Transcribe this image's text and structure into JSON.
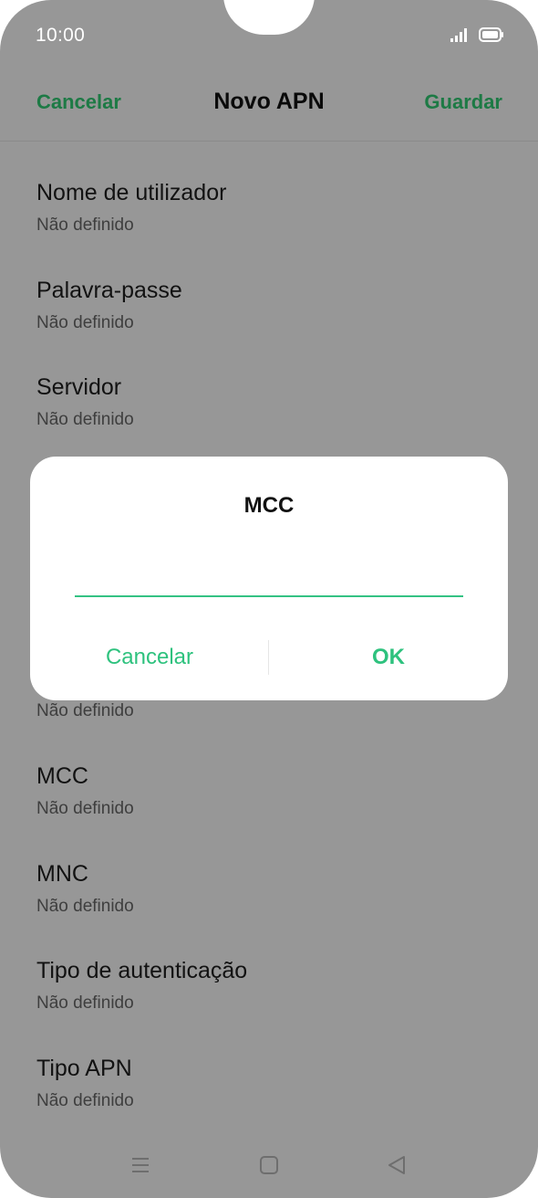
{
  "status_bar": {
    "time": "10:00",
    "signal_icon": "signal-icon",
    "battery_icon": "battery-icon"
  },
  "header": {
    "cancel_label": "Cancelar",
    "title": "Novo APN",
    "save_label": "Guardar"
  },
  "settings": {
    "items": [
      {
        "title": "Nome de utilizador",
        "value": "Não definido"
      },
      {
        "title": "Palavra-passe",
        "value": "Não definido"
      },
      {
        "title": "Servidor",
        "value": "Não definido"
      },
      {
        "title": "",
        "value": "Não definido"
      },
      {
        "title": "MCC",
        "value": "Não definido"
      },
      {
        "title": "MNC",
        "value": "Não definido"
      },
      {
        "title": "Tipo de autenticação",
        "value": "Não definido"
      },
      {
        "title": "Tipo APN",
        "value": "Não definido"
      }
    ]
  },
  "dialog": {
    "title": "MCC",
    "input_value": "",
    "cancel_label": "Cancelar",
    "ok_label": "OK"
  },
  "nav_bar": {
    "menu_icon": "menu-icon",
    "home_icon": "home-icon",
    "back_icon": "back-icon"
  },
  "colors": {
    "accent": "#2ec27e",
    "header_accent": "#1d7a45",
    "scrim_background": "#979797",
    "dialog_background": "#ffffff"
  }
}
